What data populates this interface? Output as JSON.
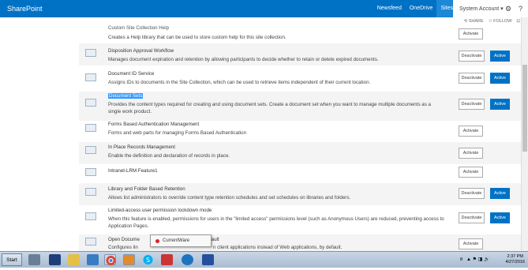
{
  "suitebar": {
    "brand": "SharePoint",
    "links": [
      "Newsfeed",
      "OneDrive",
      "Sites"
    ],
    "account": "System Account ▾",
    "settings_icon": "gear-icon",
    "help_icon": "help-icon"
  },
  "actions": {
    "share": "SHARE",
    "follow": "FOLLOW"
  },
  "features": [
    {
      "title": "Custom Site Collection Help",
      "desc": "Creates a Help library that can be used to store custom help for this site collection.",
      "button": "Activate",
      "status": ""
    },
    {
      "title": "Disposition Approval Workflow",
      "desc": "Manages document expiration and retention by allowing participants to decide whether to retain or delete expired documents.",
      "button": "Deactivate",
      "status": "Active"
    },
    {
      "title": "Document ID Service",
      "desc": "Assigns IDs to documents in the Site Collection, which can be used to retrieve items independent of their current location.",
      "button": "Deactivate",
      "status": "Active"
    },
    {
      "title": "Document Sets",
      "desc": "Provides the content types required for creating and using document sets. Create a document set when you want to manage multiple documents as a single work product.",
      "button": "Deactivate",
      "status": "Active"
    },
    {
      "title": "Forms Based Authentication Management",
      "desc": "Forms and web parts for managing Forms Based Authentication",
      "button": "Activate",
      "status": ""
    },
    {
      "title": "In Place Records Management",
      "desc": "Enable the definition and declaration of records in place.",
      "button": "Activate",
      "status": ""
    },
    {
      "title": "Intranet-LRM Feature1",
      "desc": "",
      "button": "Activate",
      "status": ""
    },
    {
      "title": "Library and Folder Based Retention",
      "desc": "Allows list administrators to override content type retention schedules and set schedules on libraries and folders.",
      "button": "Deactivate",
      "status": "Active"
    },
    {
      "title": "Limited-access user permission lockdown mode",
      "desc": "When this feature is enabled, permissions for users in the \"limited access\" permissions level (such as Anonymous Users) are reduced, preventing access to Application Pages.",
      "button": "Deactivate",
      "status": "Active"
    },
    {
      "title": "Open Docume",
      "title_tail": "Default",
      "desc": "Configures lin",
      "desc_tail": "n client applications instead of Web applications, by default.",
      "button": "Activate",
      "status": ""
    }
  ],
  "tooltip": "CurrentWare",
  "taskbar": {
    "start": "Start",
    "time": "2:37 PM",
    "date": "4/27/2016",
    "tray_label": "8"
  }
}
